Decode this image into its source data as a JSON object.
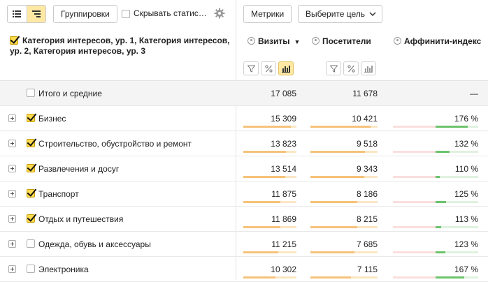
{
  "toolbar": {
    "grouping_label": "Группировки",
    "hide_stats_label": "Скрывать статис…",
    "metrics_label": "Метрики",
    "goal_label": "Выберите цель"
  },
  "header": {
    "dimension_title": "Категория интересов, ур. 1, Категория интересов, ур. 2, Категория интересов, ур. 3",
    "col_visits": "Визиты",
    "col_visitors": "Посетители",
    "col_affinity": "Аффинити-индекс",
    "sort_indicator": "▼"
  },
  "totals": {
    "label": "Итого и средние",
    "visits": "17 085",
    "visitors": "11 678",
    "affinity": "—"
  },
  "rows": [
    {
      "label": "Бизнес",
      "checked": true,
      "visits": "15 309",
      "visitors": "10 421",
      "affinity": "176 %",
      "visits_share": 0.896,
      "visitors_share": 0.892,
      "affinity_value": 176
    },
    {
      "label": "Строительство, обустройство и ремонт",
      "checked": true,
      "visits": "13 823",
      "visitors": "9 518",
      "affinity": "132 %",
      "visits_share": 0.809,
      "visitors_share": 0.815,
      "affinity_value": 132
    },
    {
      "label": "Развлечения и досуг",
      "checked": true,
      "visits": "13 514",
      "visitors": "9 343",
      "affinity": "110 %",
      "visits_share": 0.791,
      "visitors_share": 0.8,
      "affinity_value": 110
    },
    {
      "label": "Транспорт",
      "checked": true,
      "visits": "11 875",
      "visitors": "8 186",
      "affinity": "125 %",
      "visits_share": 0.695,
      "visitors_share": 0.701,
      "affinity_value": 125
    },
    {
      "label": "Отдых и путешествия",
      "checked": true,
      "visits": "11 869",
      "visitors": "8 215",
      "affinity": "113 %",
      "visits_share": 0.695,
      "visitors_share": 0.703,
      "affinity_value": 113
    },
    {
      "label": "Одежда, обувь и аксессуары",
      "checked": false,
      "visits": "11 215",
      "visitors": "7 685",
      "affinity": "123 %",
      "visits_share": 0.656,
      "visitors_share": 0.658,
      "affinity_value": 123
    },
    {
      "label": "Электроника",
      "checked": false,
      "visits": "10 302",
      "visitors": "7 115",
      "affinity": "167 %",
      "visits_share": 0.603,
      "visitors_share": 0.609,
      "affinity_value": 167
    }
  ],
  "colors": {
    "accent": "#ffdb4d",
    "bar_light": "#fbe6c4",
    "bar_fill": "#f6c27a",
    "affinity_positive": "#6cc36c"
  }
}
